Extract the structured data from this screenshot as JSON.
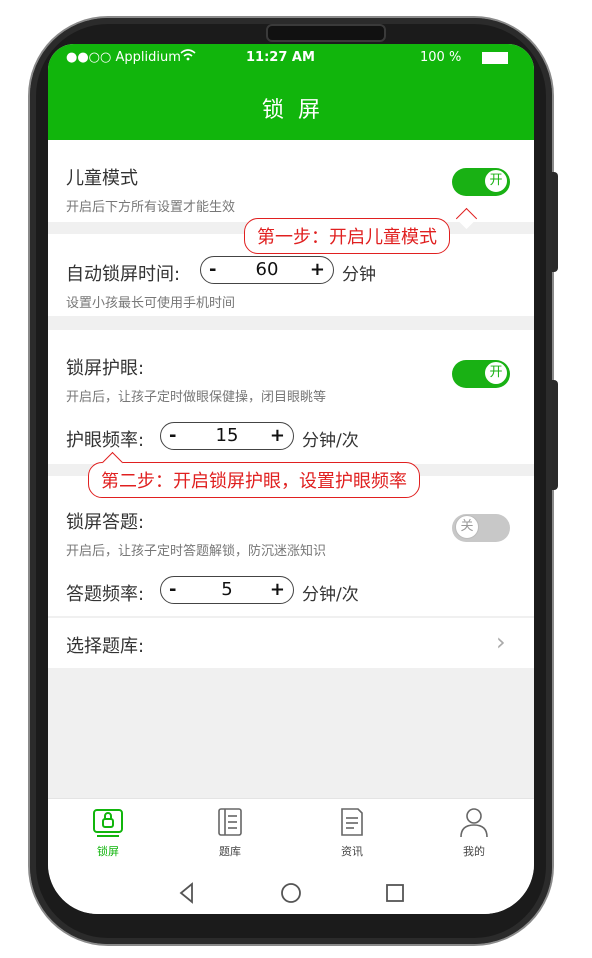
{
  "status_bar": {
    "carrier": "●●○○ Applidium",
    "time": "11:27 AM",
    "battery": "100 %"
  },
  "header": {
    "title": "锁屏"
  },
  "child_mode": {
    "label": "儿童模式",
    "hint": "开启后下方所有设置才能生效",
    "toggle_text": "开",
    "enabled": true
  },
  "auto_lock": {
    "label": "自动锁屏时间:",
    "minus": "-",
    "value": "60",
    "plus": "+",
    "unit": "分钟",
    "hint": "设置小孩最长可使用手机时间"
  },
  "eye_protection": {
    "label": "锁屏护眼:",
    "hint": "开启后，让孩子定时做眼保健操，闭目眼眺等",
    "toggle_text": "开",
    "enabled": true,
    "freq_label": "护眼频率:",
    "minus": "-",
    "value": "15",
    "plus": "+",
    "unit": "分钟/次"
  },
  "quiz": {
    "label": "锁屏答题:",
    "hint": "开启后，让孩子定时答题解锁，防沉迷涨知识",
    "toggle_text": "关",
    "enabled": false,
    "freq_label": "答题频率:",
    "minus": "-",
    "value": "5",
    "plus": "+",
    "unit": "分钟/次"
  },
  "question_bank": {
    "label": "选择题库:"
  },
  "callouts": {
    "step1": "第一步：开启儿童模式",
    "step2": "第二步：开启锁屏护眼，设置护眼频率"
  },
  "tabs": [
    {
      "label": "锁屏",
      "icon": "lock-screen-icon",
      "active": true
    },
    {
      "label": "题库",
      "icon": "question-bank-icon",
      "active": false
    },
    {
      "label": "资讯",
      "icon": "news-icon",
      "active": false
    },
    {
      "label": "我的",
      "icon": "profile-icon",
      "active": false
    }
  ],
  "colors": {
    "brand": "#11b50c",
    "callout": "#e02020"
  }
}
